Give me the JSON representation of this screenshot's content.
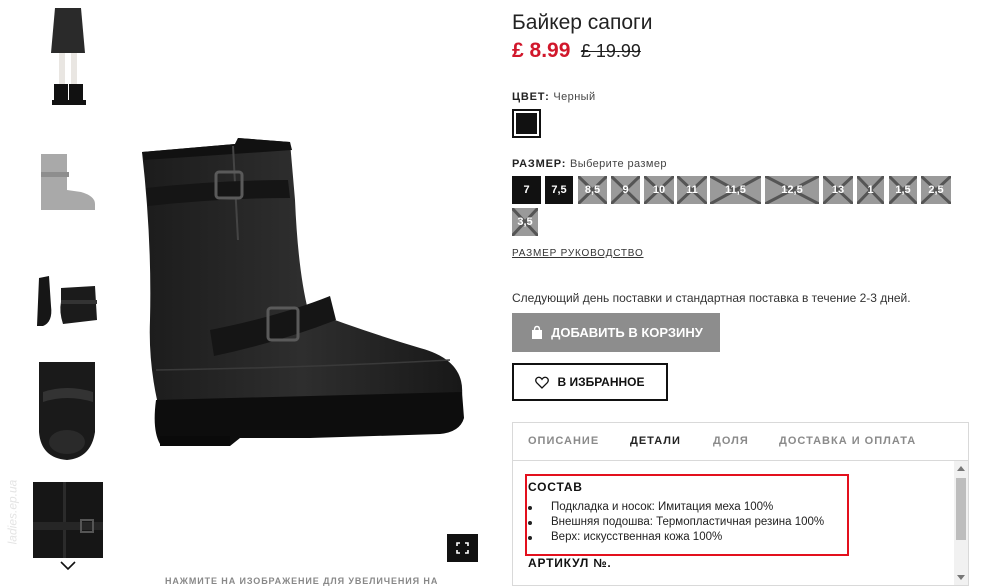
{
  "product": {
    "title": "Байкер сапоги",
    "price_now": "£ 8.99",
    "price_old": "£ 19.99"
  },
  "color": {
    "label": "ЦВЕТ:",
    "value": "Черный",
    "swatch_hex": "#111111"
  },
  "size": {
    "label": "РАЗМЕР:",
    "value": "Выберите размер",
    "options": [
      {
        "label": "7",
        "available": true
      },
      {
        "label": "7,5",
        "available": true
      },
      {
        "label": "8,5",
        "available": false
      },
      {
        "label": "9",
        "available": false
      },
      {
        "label": "10",
        "available": false
      },
      {
        "label": "11",
        "available": false
      },
      {
        "label": "11,5",
        "available": false
      },
      {
        "label": "12,5",
        "available": false
      },
      {
        "label": "13",
        "available": false
      },
      {
        "label": "1",
        "available": false
      },
      {
        "label": "1,5",
        "available": false
      },
      {
        "label": "2,5",
        "available": false
      },
      {
        "label": "3,5",
        "available": false
      }
    ],
    "guide_link": "РАЗМЕР РУКОВОДСТВО"
  },
  "delivery_text": "Следующий день поставки и стандартная поставка в течение 2-3 дней.",
  "buttons": {
    "add_to_cart": "ДОБАВИТЬ В КОРЗИНУ",
    "favorites": "В ИЗБРАННОЕ"
  },
  "tabs": [
    {
      "label": "ОПИСАНИЕ",
      "active": false
    },
    {
      "label": "ДЕТАЛИ",
      "active": true
    },
    {
      "label": "ДОЛЯ",
      "active": false
    },
    {
      "label": "ДОСТАВКА И ОПЛАТА",
      "active": false
    }
  ],
  "details": {
    "composition_title": "СОСТАВ",
    "composition_items": [
      "Подкладка и носок: Имитация меха 100%",
      "Внешняя подошва: Термопластичная резина 100%",
      "Верх: искусственная кожа 100%"
    ],
    "article_label": "АРТИКУЛ №."
  },
  "gallery": {
    "zoom_hint": "НАЖМИТЕ НА ИЗОБРАЖЕНИЕ ДЛЯ УВЕЛИЧЕНИЯ НА",
    "watermark": "ladies.ep.ua"
  },
  "colors": {
    "sale_red": "#d1172b",
    "highlight_red": "#e3101d",
    "cart_gray": "#8d8d8d"
  }
}
